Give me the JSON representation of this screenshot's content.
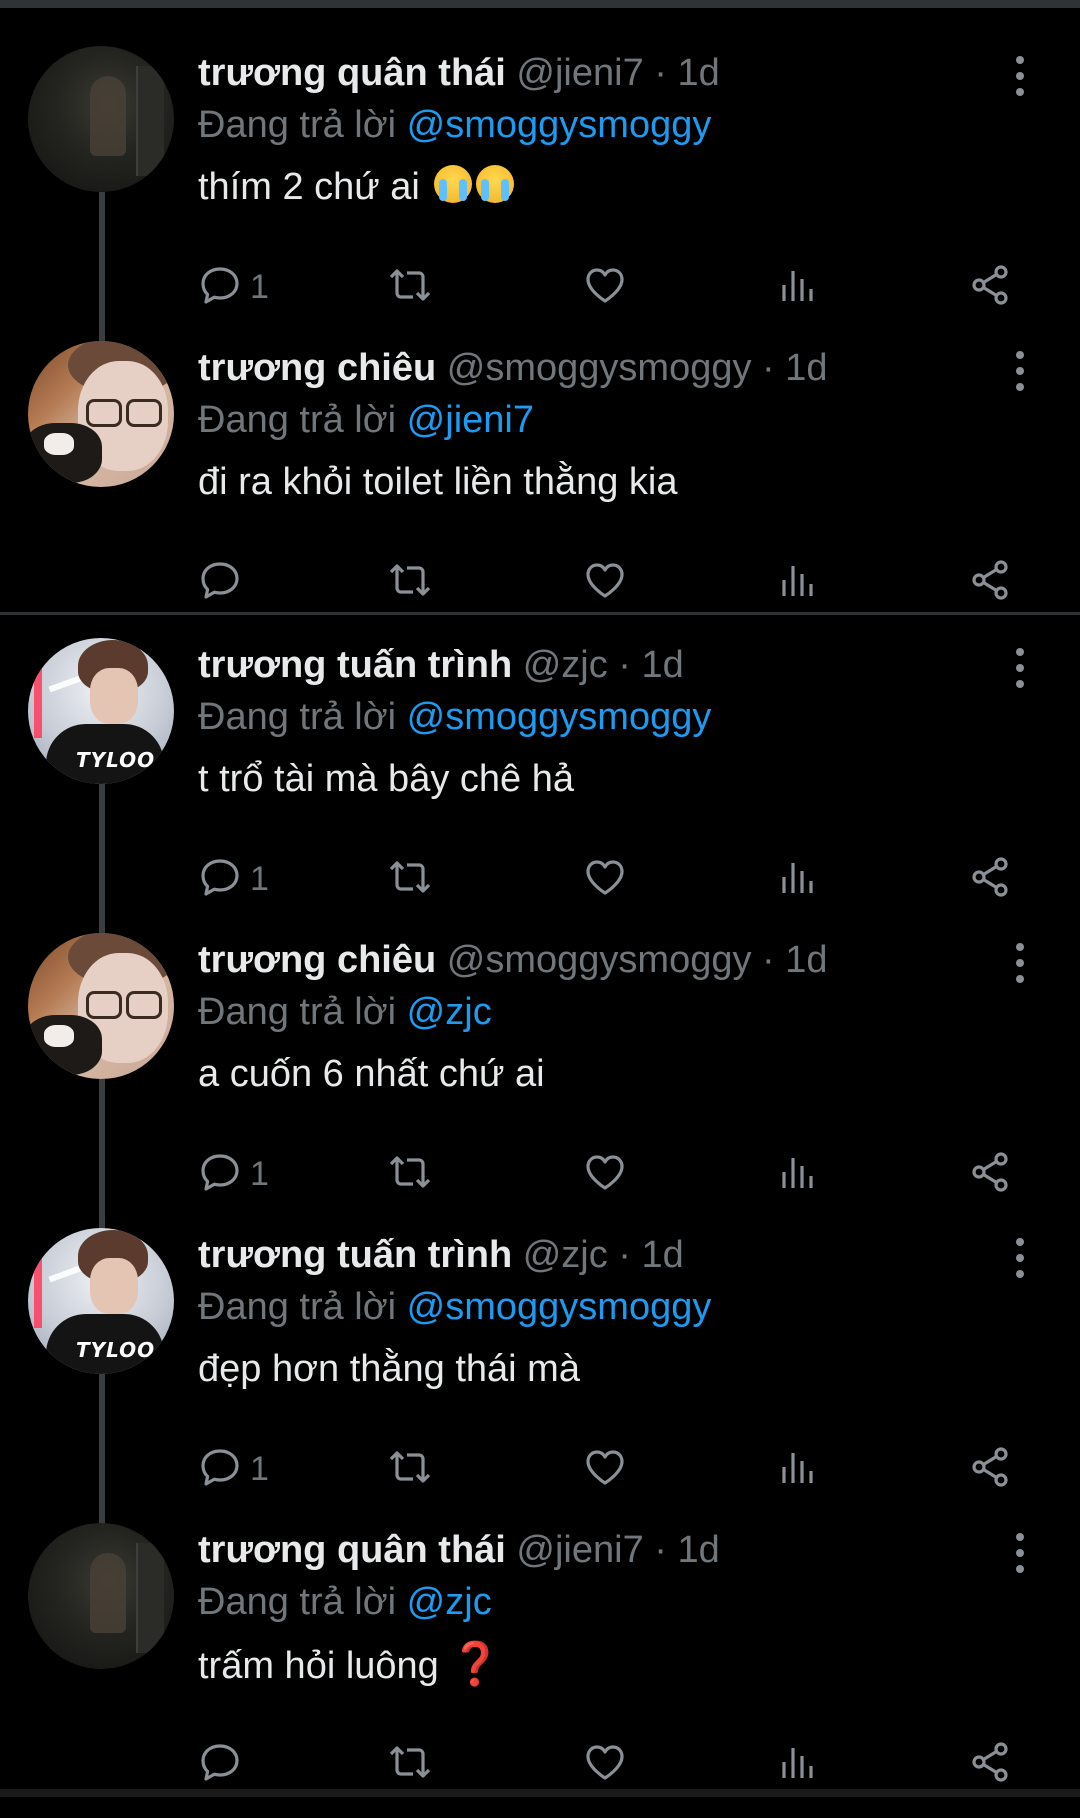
{
  "colors": {
    "background": "#000000",
    "text": "#e7e9ea",
    "muted": "#71767b",
    "mention": "#1d9bf0",
    "divider": "#2f3336"
  },
  "labels": {
    "replying_to": "Đang trả lời "
  },
  "tweets": [
    {
      "avatar": "dark",
      "name": "trương quân thái",
      "handle": "@jieni7",
      "sep": " · ",
      "time": "1d",
      "reply_to": "@smoggysmoggy",
      "text": "thím 2 chứ ai",
      "emoji": "crying-face-emoji",
      "reply_count": "1"
    },
    {
      "avatar": "glasses",
      "name": "trương chiêu",
      "handle": "@smoggysmoggy",
      "sep": " · ",
      "time": "1d",
      "reply_to": "@jieni7",
      "text": "đi ra khỏi toilet liền thằng kia",
      "reply_count": ""
    },
    {
      "avatar": "jersey",
      "name": "trương tuấn trình",
      "handle": "@zjc",
      "sep": " · ",
      "time": "1d",
      "reply_to": "@smoggysmoggy",
      "text": "t trổ tài mà bây chê hả",
      "reply_count": "1"
    },
    {
      "avatar": "glasses",
      "name": "trương chiêu",
      "handle": "@smoggysmoggy",
      "sep": " · ",
      "time": "1d",
      "reply_to": "@zjc",
      "text": "a cuốn 6 nhất chứ ai",
      "reply_count": "1"
    },
    {
      "avatar": "jersey",
      "name": "trương tuấn trình",
      "handle": "@zjc",
      "sep": " · ",
      "time": "1d",
      "reply_to": "@smoggysmoggy",
      "text": "đẹp hơn thằng thái mà",
      "reply_count": "1"
    },
    {
      "avatar": "dark",
      "name": "trương quân thái",
      "handle": "@jieni7",
      "sep": " · ",
      "time": "1d",
      "reply_to": "@zjc",
      "text": "trấm hỏi luông",
      "suffix": "❓",
      "reply_count": ""
    }
  ],
  "icons": [
    "reply-icon",
    "retweet-icon",
    "like-icon",
    "views-icon",
    "share-icon",
    "more-options-icon"
  ],
  "avatar_text": {
    "jersey": "TYLOO"
  }
}
